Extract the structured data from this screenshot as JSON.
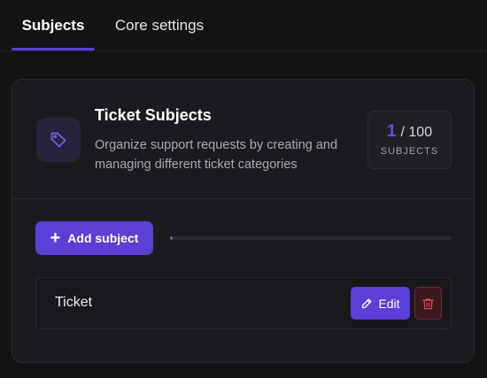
{
  "tabs": [
    {
      "label": "Subjects",
      "active": true
    },
    {
      "label": "Core settings",
      "active": false
    }
  ],
  "card": {
    "title": "Ticket Subjects",
    "description": "Organize support requests by creating and managing different ticket categories",
    "icon": "tag-icon",
    "counter": {
      "current": "1",
      "max": "/ 100",
      "label": "SUBJECTS"
    }
  },
  "toolbar": {
    "add_label": "Add subject",
    "add_icon": "plus-icon",
    "progress": 0.01
  },
  "subjects": [
    {
      "label": "Ticket",
      "edit_label": "Edit"
    }
  ],
  "colors": {
    "accent": "#5b3fd6",
    "background": "#141417",
    "card": "#1b1b1f",
    "danger": "#e04a55"
  }
}
